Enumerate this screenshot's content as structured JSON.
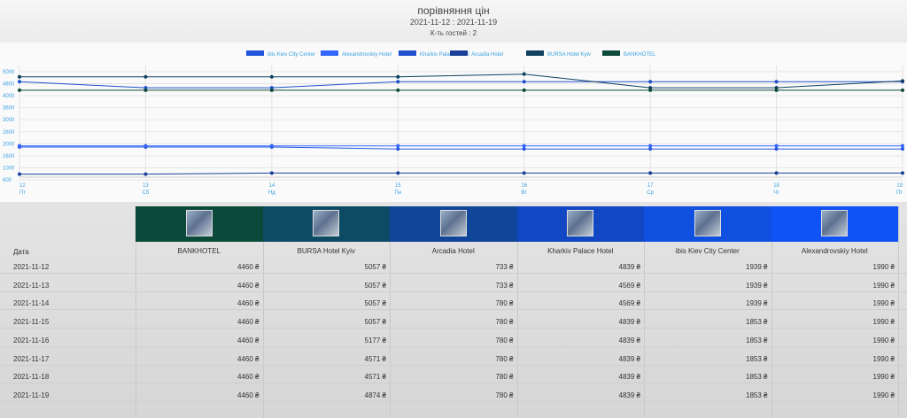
{
  "header": {
    "title": "порівняння цін",
    "dates": "2021-11-12 : 2021-11-19",
    "guests": "К-ть гостей : 2"
  },
  "chart_data": {
    "type": "line",
    "y_ticks": [
      "5000",
      "4800",
      "4000",
      "3600",
      "3000",
      "2600",
      "2000",
      "1600",
      "1000",
      "600"
    ],
    "x_ticks": [
      {
        "day": "12",
        "dow": "Пт"
      },
      {
        "day": "13",
        "dow": "Сб"
      },
      {
        "day": "14",
        "dow": "Нд"
      },
      {
        "day": "15",
        "dow": "Пн"
      },
      {
        "day": "16",
        "dow": "Вт"
      },
      {
        "day": "17",
        "dow": "Ср"
      },
      {
        "day": "18",
        "dow": "Чт"
      },
      {
        "day": "19",
        "dow": "Пт"
      }
    ],
    "ylim": [
      600,
      5400
    ],
    "grid": true,
    "legend_position": "top",
    "series": [
      {
        "name": "ibis Kiev City Center",
        "color": "#2255dd",
        "values": [
          1939,
          1939,
          1939,
          1853,
          1853,
          1853,
          1853,
          1853
        ]
      },
      {
        "name": "Alexandrovskiy Hotel",
        "color": "#3366ff",
        "values": [
          1990,
          1990,
          1990,
          1990,
          1990,
          1990,
          1990,
          1990
        ]
      },
      {
        "name": "Kharkiv Palace Hotel",
        "color": "#1e4fcc",
        "values": [
          4839,
          4569,
          4569,
          4839,
          4839,
          4839,
          4839,
          4839
        ]
      },
      {
        "name": "Arcadia Hotel",
        "color": "#1a3f99",
        "values": [
          733,
          733,
          780,
          780,
          780,
          780,
          780,
          780
        ]
      },
      {
        "name": "BURSA Hotel Kyiv",
        "color": "#0f4060",
        "values": [
          5057,
          5057,
          5057,
          5057,
          5177,
          4571,
          4571,
          4874
        ]
      },
      {
        "name": "BANKHOTEL",
        "color": "#0d4a3a",
        "values": [
          4460,
          4460,
          4460,
          4460,
          4460,
          4460,
          4460,
          4460
        ]
      }
    ]
  },
  "table": {
    "date_label": "Дата",
    "columns": [
      {
        "name": "BANKHOTEL",
        "color": "#0b4a3a"
      },
      {
        "name": "BURSA Hotel Kyiv",
        "color": "#0d4a63"
      },
      {
        "name": "Arcadia Hotel",
        "color": "#0f4699"
      },
      {
        "name": "Kharkiv Palace Hotel",
        "color": "#1247c4"
      },
      {
        "name": "ibis Kiev City Center",
        "color": "#1050e0"
      },
      {
        "name": "Alexandrovskiy Hotel",
        "color": "#0f52f5"
      }
    ],
    "rows": [
      {
        "date": "2021-11-12",
        "prices": [
          "4460 ₴",
          "5057 ₴",
          "733 ₴",
          "4839 ₴",
          "1939 ₴",
          "1990 ₴"
        ]
      },
      {
        "date": "2021-11-13",
        "prices": [
          "4460 ₴",
          "5057 ₴",
          "733 ₴",
          "4569 ₴",
          "1939 ₴",
          "1990 ₴"
        ]
      },
      {
        "date": "2021-11-14",
        "prices": [
          "4460 ₴",
          "5057 ₴",
          "780 ₴",
          "4569 ₴",
          "1939 ₴",
          "1990 ₴"
        ]
      },
      {
        "date": "2021-11-15",
        "prices": [
          "4460 ₴",
          "5057 ₴",
          "780 ₴",
          "4839 ₴",
          "1853 ₴",
          "1990 ₴"
        ]
      },
      {
        "date": "2021-11-16",
        "prices": [
          "4460 ₴",
          "5177 ₴",
          "780 ₴",
          "4839 ₴",
          "1853 ₴",
          "1990 ₴"
        ]
      },
      {
        "date": "2021-11-17",
        "prices": [
          "4460 ₴",
          "4571 ₴",
          "780 ₴",
          "4839 ₴",
          "1853 ₴",
          "1990 ₴"
        ]
      },
      {
        "date": "2021-11-18",
        "prices": [
          "4460 ₴",
          "4571 ₴",
          "780 ₴",
          "4839 ₴",
          "1853 ₴",
          "1990 ₴"
        ]
      },
      {
        "date": "2021-11-19",
        "prices": [
          "4460 ₴",
          "4874 ₴",
          "780 ₴",
          "4839 ₴",
          "1853 ₴",
          "1990 ₴"
        ]
      }
    ]
  }
}
